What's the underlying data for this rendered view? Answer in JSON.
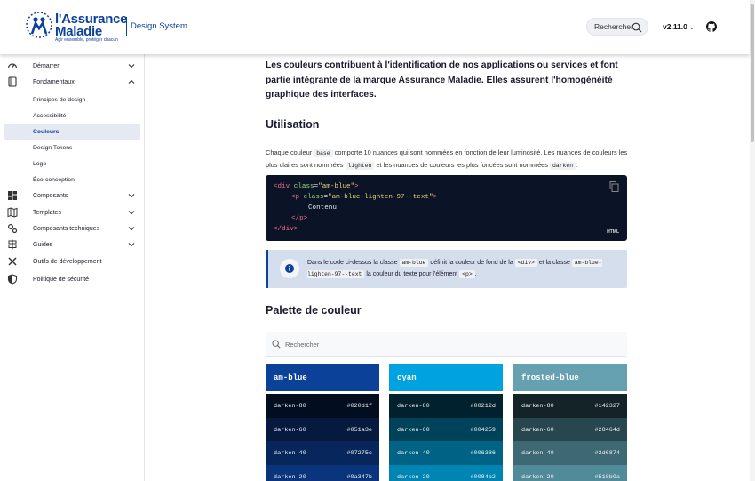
{
  "header": {
    "logo_line1": "l'Assurance",
    "logo_line2": "Maladie",
    "logo_tagline": "Agir ensemble, protéger chacun",
    "product": "Design System",
    "search_label": "Rechercher",
    "version": "v2.11.0",
    "icons": {
      "search": "search-icon",
      "github": "github-icon",
      "chevron": "chevron-down-icon"
    }
  },
  "sidebar": {
    "items": [
      {
        "label": "Démarrer",
        "icon": "gauge-icon",
        "expandable": true,
        "expanded": false
      },
      {
        "label": "Fondamentaux",
        "icon": "book-icon",
        "expandable": true,
        "expanded": true
      },
      {
        "label": "Principes de design",
        "sub": true
      },
      {
        "label": "Accessibilité",
        "sub": true
      },
      {
        "label": "Couleurs",
        "sub": true,
        "active": true
      },
      {
        "label": "Design Tokens",
        "sub": true
      },
      {
        "label": "Logo",
        "sub": true
      },
      {
        "label": "Éco-conception",
        "sub": true
      },
      {
        "label": "Composants",
        "icon": "dashboard-icon",
        "expandable": true
      },
      {
        "label": "Templates",
        "icon": "map-icon",
        "expandable": true
      },
      {
        "label": "Composants techniques",
        "icon": "cogs-icon",
        "expandable": true
      },
      {
        "label": "Guides",
        "icon": "signpost-icon",
        "expandable": true
      },
      {
        "label": "Outils de développement",
        "icon": "tools-icon"
      },
      {
        "label": "Politique de sécurité",
        "icon": "shield-icon"
      }
    ]
  },
  "main": {
    "intro": "Les couleurs contribuent à l'identification de nos applications ou services et font partie intégrante de la marque Assurance Maladie. Elles assurent l'homogénéité graphique des interfaces.",
    "usage_title": "Utilisation",
    "usage_p1": "Chaque couleur",
    "usage_code1": "base",
    "usage_p2": "comporte 10 nuances qui sont nommées en fonction de leur luminosité. Les nuances de couleurs les plus claires sont nommées",
    "usage_code2": "lighten",
    "usage_p3": "et les nuances de couleurs les plus foncées sont nommées",
    "usage_code3": "darken",
    "usage_p4": ".",
    "code": {
      "l1_open": "<div ",
      "l1_attr": "class",
      "l1_eq": "=",
      "l1_val": "\"am-blue\"",
      "l1_close": ">",
      "l2_open": "<p ",
      "l2_attr": "class",
      "l2_eq": "=",
      "l2_val": "\"am-blue-lighten-97--text\"",
      "l2_close": ">",
      "l3": "Contenu",
      "l4": "</p>",
      "l5": "</div>",
      "lang": "HTML"
    },
    "alert": {
      "t1": "Dans le code ci-dessus la classe",
      "c1": "am-blue",
      "t2": "définit la couleur de fond de la",
      "c2": "<div>",
      "t3": "et la classe",
      "c3": "am-blue-lighten-97--text",
      "t4": "la couleur du texte pour l'élément",
      "c4": "<p>",
      "t5": "."
    },
    "palette_title": "Palette de couleur",
    "palette_search_placeholder": "Rechercher",
    "palettes": [
      {
        "name": "am-blue",
        "head_color": "#0c419a",
        "shades": [
          {
            "name": "darken-80",
            "hex": "#020d1f"
          },
          {
            "name": "darken-60",
            "hex": "#051a3e"
          },
          {
            "name": "darken-40",
            "hex": "#07275c"
          },
          {
            "name": "darken-20",
            "hex": "#0a347b"
          }
        ]
      },
      {
        "name": "cyan",
        "head_color": "#00a3e0",
        "shades": [
          {
            "name": "darken-80",
            "hex": "#00212d"
          },
          {
            "name": "darken-60",
            "hex": "#004259"
          },
          {
            "name": "darken-40",
            "hex": "#006386"
          },
          {
            "name": "darken-20",
            "hex": "#0084b2"
          }
        ]
      },
      {
        "name": "frosted-blue",
        "head_color": "#66a1b2",
        "shades": [
          {
            "name": "darken-80",
            "hex": "#142327"
          },
          {
            "name": "darken-60",
            "hex": "#28464d"
          },
          {
            "name": "darken-40",
            "hex": "#3d6874"
          },
          {
            "name": "darken-20",
            "hex": "#518b9a"
          }
        ]
      }
    ]
  }
}
